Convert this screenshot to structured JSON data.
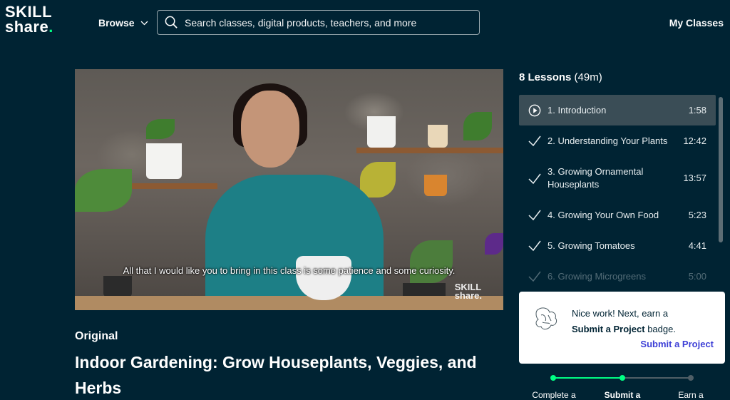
{
  "header": {
    "logo_line1": "SKILL",
    "logo_line2": "share",
    "browse_label": "Browse",
    "search_placeholder": "Search classes, digital products, teachers, and more",
    "my_classes_label": "My Classes"
  },
  "video": {
    "caption": "All that I would like you to bring in this class is some patience and some curiosity.",
    "watermark_line1": "SKILL",
    "watermark_line2": "share."
  },
  "course": {
    "badge": "Original",
    "title": "Indoor Gardening: Grow Houseplants, Veggies, and Herbs"
  },
  "lessons": {
    "count_label": "8 Lessons",
    "total_duration": "(49m)",
    "items": [
      {
        "label": "1. Introduction",
        "duration": "1:58",
        "state": "playing"
      },
      {
        "label": "2. Understanding Your Plants",
        "duration": "12:42",
        "state": "completed"
      },
      {
        "label": "3. Growing Ornamental Houseplants",
        "duration": "13:57",
        "state": "completed"
      },
      {
        "label": "4. Growing Your Own Food",
        "duration": "5:23",
        "state": "completed"
      },
      {
        "label": "5. Growing Tomatoes",
        "duration": "4:41",
        "state": "completed"
      },
      {
        "label": "6. Growing Microgreens",
        "duration": "5:00",
        "state": "completed"
      }
    ]
  },
  "project_card": {
    "line1": "Nice work! Next, earn a",
    "line2_bold": "Submit a Project",
    "line2_rest": " badge.",
    "link": "Submit a Project"
  },
  "progress": {
    "steps": [
      "Complete a",
      "Submit a",
      "Earn a"
    ],
    "completed_steps": 2
  },
  "colors": {
    "background": "#002333",
    "accent": "#00ff84",
    "link": "#3d3fd6"
  }
}
